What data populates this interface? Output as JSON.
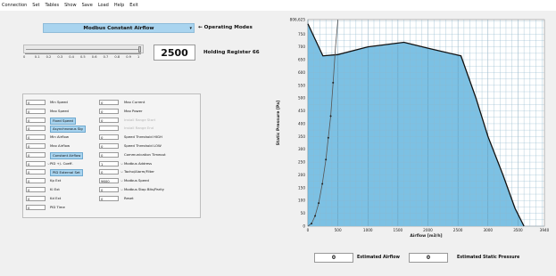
{
  "menu": [
    "Connection",
    "Set",
    "Tables",
    "Show",
    "Save",
    "Load",
    "Help",
    "Exit"
  ],
  "mode": {
    "selected": "Modbus Constant Airflow",
    "label": "Operating Modes"
  },
  "slider": {
    "scale": [
      "0",
      "0.1",
      "0.2",
      "0.3",
      "0.4",
      "0.5",
      "0.6",
      "0.7",
      "0.8",
      "0.9",
      "1"
    ],
    "position": 1.0
  },
  "register": {
    "value": "2500",
    "label": "Holding Register 66"
  },
  "params_left": [
    {
      "value": "0",
      "label": "Min Speed",
      "style": "normal"
    },
    {
      "value": "0",
      "label": "Max Speed",
      "style": "normal"
    },
    {
      "value": "0",
      "label": "Fixed Speed",
      "style": "highlight"
    },
    {
      "value": "0",
      "label": "Asynchronous Sig",
      "style": "highlight"
    },
    {
      "value": "0",
      "label": "Min Airflow",
      "style": "normal"
    },
    {
      "value": "0",
      "label": "Max Airflow",
      "style": "normal"
    },
    {
      "value": "0",
      "label": "Constant Airflow",
      "style": "highlight"
    },
    {
      "value": "0",
      "label": "PID +/- Coeff.",
      "style": "dropdown"
    },
    {
      "value": "0",
      "label": "PID External Set",
      "style": "highlight"
    },
    {
      "value": "0",
      "label": "Kp Ext",
      "style": "normal"
    },
    {
      "value": "0",
      "label": "Ki Ext",
      "style": "normal"
    },
    {
      "value": "0",
      "label": "Kd Ext",
      "style": "normal"
    },
    {
      "value": "0",
      "label": "PID Time",
      "style": "normal"
    }
  ],
  "params_right": [
    {
      "value": "0",
      "label": "Max Current",
      "style": "normal"
    },
    {
      "value": "0",
      "label": "Max Power",
      "style": "normal"
    },
    {
      "value": "0",
      "label": "Install Range Start",
      "style": "disabled"
    },
    {
      "value": "",
      "label": "Install Range End",
      "style": "disabled"
    },
    {
      "value": "0",
      "label": "Speed Threshold HIGH",
      "style": "normal"
    },
    {
      "value": "0",
      "label": "Speed Threshold LOW",
      "style": "normal"
    },
    {
      "value": "0",
      "label": "Communication Timeout",
      "style": "normal"
    },
    {
      "value": "1",
      "label": "Modbus Address",
      "style": "dropdown"
    },
    {
      "value": "0",
      "label": "Tacho/Alarm/Filter",
      "style": "dropdown"
    },
    {
      "value": "9600",
      "label": "Modbus Speed",
      "style": "dropdown"
    },
    {
      "value": "0",
      "label": "Modbus Stop Bits/Parity",
      "style": "dropdown"
    },
    {
      "value": "0",
      "label": "Reset",
      "style": "normal"
    }
  ],
  "chart_data": {
    "type": "area",
    "ylabel": "Static Pressure [Pa]",
    "xlabel": "Airflow [m3/h]",
    "ylim": [
      0,
      806.625
    ],
    "xlim": [
      0,
      3940
    ],
    "y_ticks": [
      "806,625",
      "750",
      "700",
      "650",
      "600",
      "550",
      "500",
      "450",
      "400",
      "350",
      "300",
      "250",
      "200",
      "150",
      "100",
      "50",
      "0"
    ],
    "x_ticks": [
      "0",
      "500",
      "1000",
      "1500",
      "2000",
      "2500",
      "3000",
      "3500",
      "3940"
    ],
    "grid": true,
    "curve": {
      "x": [
        0,
        250,
        500,
        1000,
        1600,
        2000,
        2550,
        2800,
        3000,
        3250,
        3450,
        3600
      ],
      "y": [
        790,
        665,
        670,
        700,
        718,
        695,
        665,
        500,
        350,
        200,
        70,
        0
      ]
    },
    "fill_color": "#7cc1e4",
    "system_curve": {
      "x": [
        0,
        60,
        120,
        180,
        240,
        300,
        340,
        380,
        420,
        460,
        500
      ],
      "y": [
        0,
        10,
        40,
        90,
        165,
        260,
        345,
        430,
        560,
        700,
        806
      ]
    }
  },
  "estimates": [
    {
      "value": "0",
      "label": "Estimated Airflow"
    },
    {
      "value": "0",
      "label": "Estimated Static Pressure"
    }
  ]
}
